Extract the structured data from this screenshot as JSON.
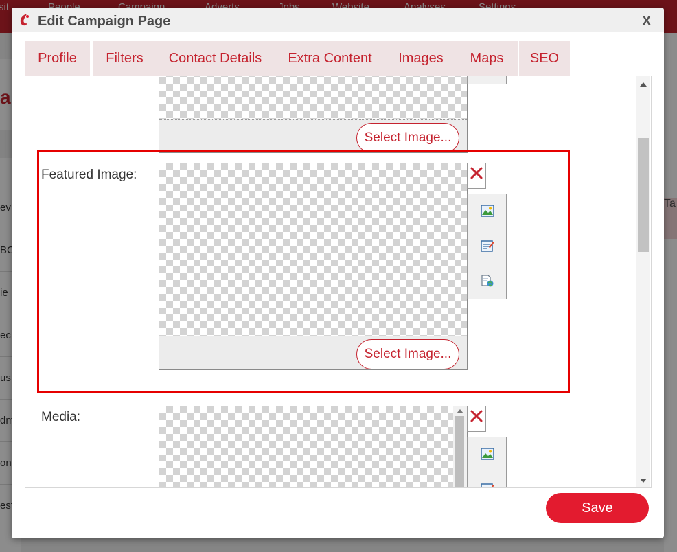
{
  "dialog": {
    "title": "Edit Campaign Page",
    "close_label": "X"
  },
  "background": {
    "nav_items": [
      "sit",
      "People",
      "Campaign",
      "Adverts",
      "Jobs",
      "Website",
      "Analyses",
      "Settings"
    ],
    "rows": [
      "ev",
      "BC",
      "ie",
      "ec",
      "ust",
      "dm",
      "on",
      "est"
    ],
    "page_heading": "a",
    "right_col_label": "Ta"
  },
  "tabs": [
    {
      "label": "Profile"
    },
    {
      "label": "Filters"
    },
    {
      "label": "Contact Details"
    },
    {
      "label": "Extra Content"
    },
    {
      "label": "Images"
    },
    {
      "label": "Maps"
    },
    {
      "label": "SEO"
    }
  ],
  "fields": {
    "previous_image": {
      "select_label": "Select Image..."
    },
    "featured_image": {
      "label": "Featured Image:",
      "select_label": "Select Image..."
    },
    "media": {
      "label": "Media:"
    }
  },
  "buttons": {
    "save_label": "Save"
  },
  "colors": {
    "accent": "#c5232f",
    "save": "#e31b2f",
    "highlight": "#e60000"
  },
  "icons": [
    "logo-icon",
    "delete-icon",
    "image-icon",
    "edit-icon",
    "link-icon"
  ]
}
